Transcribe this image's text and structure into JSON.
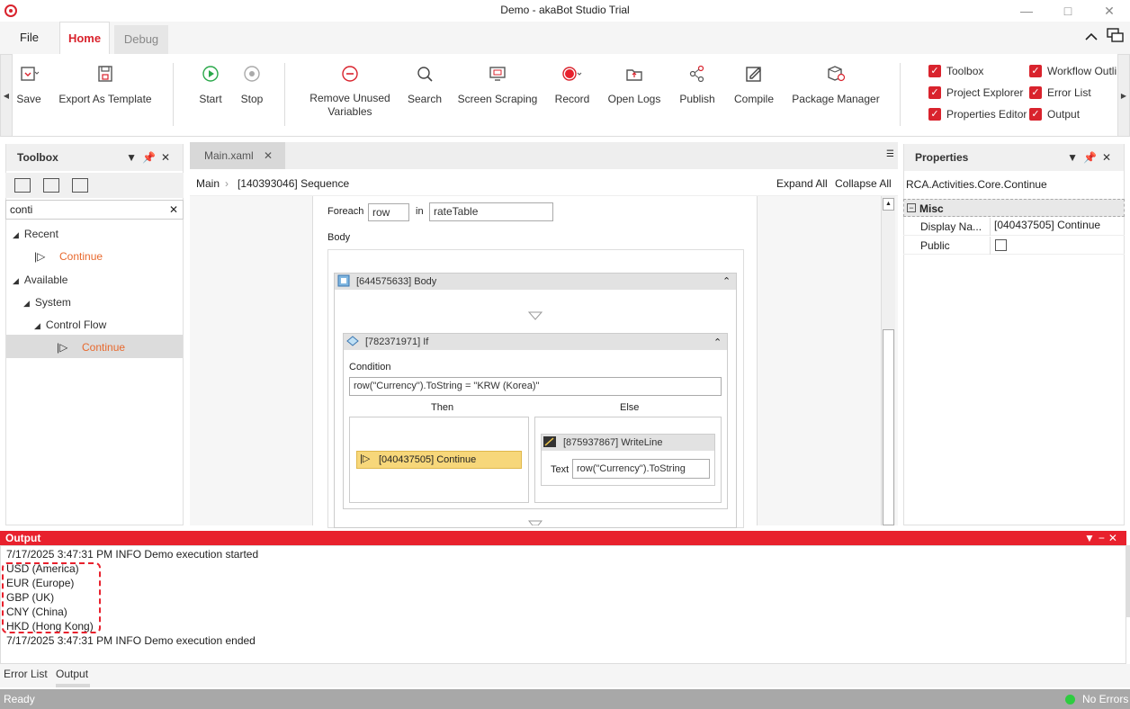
{
  "window": {
    "title": "Demo - akaBot Studio Trial",
    "controls": [
      "minimize",
      "maximize",
      "close"
    ]
  },
  "menu": {
    "tabs": [
      {
        "label": "File"
      },
      {
        "label": "Home",
        "active": true
      },
      {
        "label": "Debug"
      }
    ]
  },
  "ribbon": {
    "buttons": [
      {
        "label": "Save",
        "icon": "save-icon"
      },
      {
        "label": "Export As Template",
        "icon": "export-template-icon"
      },
      {
        "label": "Start",
        "icon": "play-icon"
      },
      {
        "label": "Stop",
        "icon": "stop-icon"
      },
      {
        "label": "Remove Unused Variables",
        "line1": "Remove Unused",
        "line2": "Variables",
        "icon": "remove-icon"
      },
      {
        "label": "Search",
        "icon": "search-icon"
      },
      {
        "label": "Screen Scraping",
        "icon": "screen-scraping-icon"
      },
      {
        "label": "Record",
        "icon": "record-icon"
      },
      {
        "label": "Open Logs",
        "icon": "folder-icon"
      },
      {
        "label": "Publish",
        "icon": "share-icon"
      },
      {
        "label": "Compile",
        "icon": "compile-icon"
      },
      {
        "label": "Package Manager",
        "icon": "package-icon"
      }
    ],
    "panels": [
      {
        "label": "Toolbox",
        "checked": true
      },
      {
        "label": "Project Explorer",
        "checked": true
      },
      {
        "label": "Properties Editor",
        "checked": true
      },
      {
        "label": "Workflow Outli",
        "checked": true
      },
      {
        "label": "Error List",
        "checked": true
      },
      {
        "label": "Output",
        "checked": true
      }
    ]
  },
  "toolbox": {
    "title": "Toolbox",
    "search_value": "conti",
    "tree": {
      "recent": "Recent",
      "recent_item_prefix": "Conti",
      "recent_item_suffix": "nue",
      "available": "Available",
      "system": "System",
      "control_flow": "Control Flow",
      "control_item_prefix": "Conti",
      "control_item_suffix": "nue"
    }
  },
  "designer": {
    "tab_label": "Main.xaml",
    "breadcrumb": [
      "Main",
      "[140393046] Sequence"
    ],
    "expand_all": "Expand All",
    "collapse_all": "Collapse All",
    "foreach_label": "Foreach",
    "foreach_var": "row",
    "in_label": "in",
    "foreach_collection": "rateTable",
    "body_label": "Body",
    "body_activity": "[644575633] Body",
    "if_activity": "[782371971] If",
    "condition_label": "Condition",
    "condition_value": "row(\"Currency\").ToString = \"KRW (Korea)\"",
    "then_label": "Then",
    "else_label": "Else",
    "continue_activity": "[040437505] Continue",
    "writeline_activity": "[875937867] WriteLine",
    "text_label": "Text",
    "text_value": "row(\"Currency\").ToString"
  },
  "properties": {
    "title": "Properties",
    "type_name": "RCA.Activities.Core.Continue",
    "category": "Misc",
    "rows": [
      {
        "name": "Display Na...",
        "value": "[040437505] Continue"
      },
      {
        "name": "Public",
        "value": ""
      }
    ]
  },
  "output": {
    "title": "Output",
    "lines": [
      "7/17/2025 3:47:31 PM INFO Demo execution started",
      "USD (America)",
      "EUR (Europe)",
      "GBP (UK)",
      "CNY (China)",
      "HKD (Hong Kong)",
      "7/17/2025 3:47:31 PM INFO Demo execution ended"
    ]
  },
  "bottom_tabs": [
    "Error List",
    "Output"
  ],
  "status": {
    "left": "Ready",
    "right": "No Errors",
    "indicator_color": "#2ecc40"
  },
  "colors": {
    "accent": "#d9232d",
    "output_header": "#e8212d",
    "continue_fill": "#f7d77a"
  }
}
